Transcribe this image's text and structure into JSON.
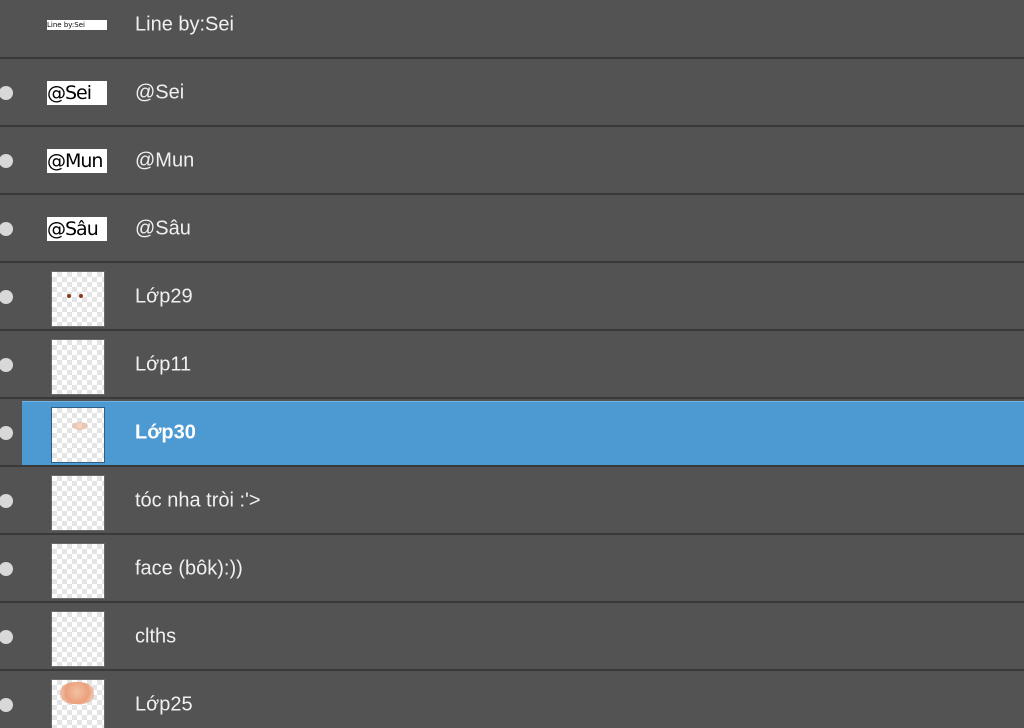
{
  "layers": [
    {
      "name": "Line by:Sei",
      "thumb_text": "Line by:Sei",
      "thumb_kind": "text-tiny",
      "visible": false,
      "selected": false
    },
    {
      "name": "@Sei",
      "thumb_text": "@Sei",
      "thumb_kind": "text",
      "visible": true,
      "selected": false
    },
    {
      "name": "@Mun",
      "thumb_text": "@Mun",
      "thumb_kind": "text",
      "visible": true,
      "selected": false
    },
    {
      "name": "@Sâu",
      "thumb_text": "@Sâu",
      "thumb_kind": "text",
      "visible": true,
      "selected": false
    },
    {
      "name": "Lớp29",
      "thumb_kind": "dots",
      "visible": true,
      "selected": false
    },
    {
      "name": "Lớp11",
      "thumb_kind": "blank",
      "visible": true,
      "selected": false
    },
    {
      "name": "Lớp30",
      "thumb_kind": "smudge",
      "visible": true,
      "selected": true
    },
    {
      "name": "tóc nha tròi :'>",
      "thumb_kind": "blank",
      "visible": true,
      "selected": false
    },
    {
      "name": "face (bôk):))",
      "thumb_kind": "blank",
      "visible": true,
      "selected": false
    },
    {
      "name": "clths",
      "thumb_kind": "blank",
      "visible": true,
      "selected": false
    },
    {
      "name": "Lớp25",
      "thumb_kind": "blob",
      "visible": true,
      "selected": false
    }
  ],
  "colors": {
    "panel_bg": "#535353",
    "row_divider": "#393939",
    "selection": "#4d99d2",
    "label_text": "#f0f0f0",
    "eye_dot": "#d8d8d8"
  }
}
